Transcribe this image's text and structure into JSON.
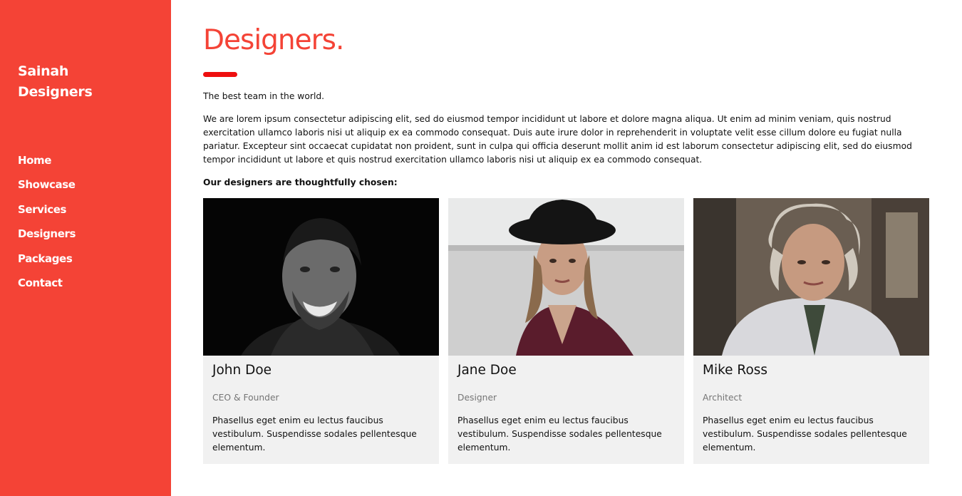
{
  "sidebar": {
    "brand_line1": "Sainah",
    "brand_line2": "Designers",
    "nav": [
      {
        "label": "Home"
      },
      {
        "label": "Showcase"
      },
      {
        "label": "Services"
      },
      {
        "label": "Designers"
      },
      {
        "label": "Packages"
      },
      {
        "label": "Contact"
      }
    ]
  },
  "main": {
    "title": "Designers.",
    "tagline": "The best team in the world.",
    "intro": "We are lorem ipsum consectetur adipiscing elit, sed do eiusmod tempor incididunt ut labore et dolore magna aliqua. Ut enim ad minim veniam, quis nostrud exercitation ullamco laboris nisi ut aliquip ex ea commodo consequat. Duis aute irure dolor in reprehenderit in voluptate velit esse cillum dolore eu fugiat nulla pariatur. Excepteur sint occaecat cupidatat non proident, sunt in culpa qui officia deserunt mollit anim id est laborum consectetur adipiscing elit, sed do eiusmod tempor incididunt ut labore et quis nostrud exercitation ullamco laboris nisi ut aliquip ex ea commodo consequat.",
    "chosen_heading": "Our designers are thoughtfully chosen:",
    "designers": [
      {
        "name": "John Doe",
        "role": "CEO & Founder",
        "description": "Phasellus eget enim eu lectus faucibus vestibulum. Suspendisse sodales pellentesque elementum."
      },
      {
        "name": "Jane Doe",
        "role": "Designer",
        "description": "Phasellus eget enim eu lectus faucibus vestibulum. Suspendisse sodales pellentesque elementum."
      },
      {
        "name": "Mike Ross",
        "role": "Architect",
        "description": "Phasellus eget enim eu lectus faucibus vestibulum. Suspendisse sodales pellentesque elementum."
      }
    ]
  },
  "colors": {
    "accent": "#f44336",
    "title_bar": "#ee0f0f",
    "card_bg": "#f1f1f1",
    "role_text": "#757575"
  }
}
